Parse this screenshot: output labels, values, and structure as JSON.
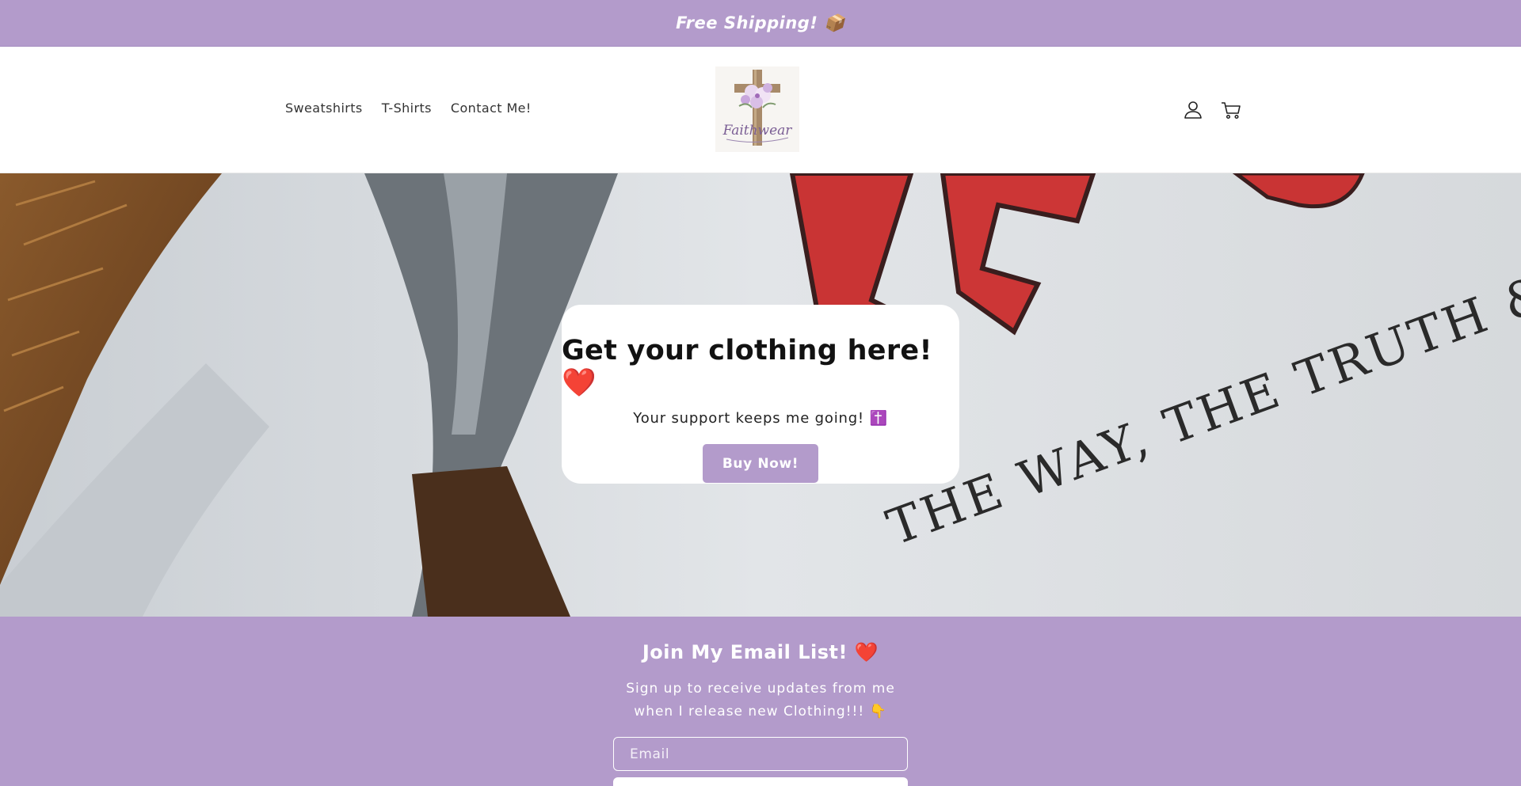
{
  "announcement": {
    "text": "Free Shipping! 📦"
  },
  "header": {
    "nav": [
      {
        "label": "Sweatshirts"
      },
      {
        "label": "T-Shirts"
      },
      {
        "label": "Contact Me!"
      }
    ],
    "logo_text": "Faithwear",
    "icons": [
      "account-icon",
      "cart-icon"
    ]
  },
  "hero": {
    "title": "Get your clothing here! ❤️",
    "subtitle": "Your support keeps me going! ✝️",
    "button_label": "Buy Now!",
    "background_text": [
      "THE WAY, THE TRUTH & T"
    ]
  },
  "newsletter": {
    "title": "Join My Email List! ❤️",
    "description": "Sign up to receive updates from me when I release new Clothing!!! 👇",
    "email_placeholder": "Email"
  },
  "colors": {
    "accent": "#b39bcb",
    "white": "#ffffff",
    "text": "#121212"
  }
}
